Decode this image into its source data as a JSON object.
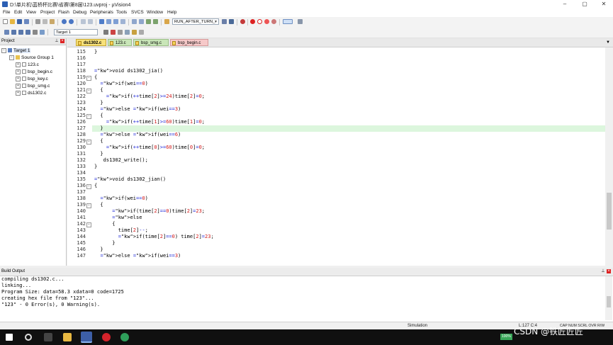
{
  "window": {
    "title": "D:\\单片机\\蓝桥杯比赛\\省赛\\第8届\\123.uvproj - µVision4",
    "minimize": "–",
    "maximize": "▢",
    "close": "✕"
  },
  "menu": [
    "File",
    "Edit",
    "View",
    "Project",
    "Flash",
    "Debug",
    "Peripherals",
    "Tools",
    "SVCS",
    "Window",
    "Help"
  ],
  "toolbar": {
    "command_combo": "RUN_AFTER_TURN_",
    "target_combo": "Target 1"
  },
  "project_pane": {
    "title": "Project",
    "tree": {
      "target": "Target 1",
      "group": "Source Group 1",
      "files": [
        "123.c",
        "bsp_begin.c",
        "bsp_key.c",
        "bsp_smg.c",
        "ds1302.c"
      ]
    }
  },
  "editor": {
    "tabs": [
      {
        "label": "ds1302.c",
        "active": true
      },
      {
        "label": "123.c",
        "active": false
      },
      {
        "label": "bsp_smg.c",
        "active": false
      },
      {
        "label": "bsp_begin.c",
        "active": false
      }
    ],
    "cursor_line": "127",
    "lines": [
      {
        "n": "115",
        "t": "}",
        "fold": ""
      },
      {
        "n": "116",
        "t": "",
        "fold": ""
      },
      {
        "n": "117",
        "t": "",
        "fold": ""
      },
      {
        "n": "118",
        "t": "void ds1302_jia()",
        "fold": ""
      },
      {
        "n": "119",
        "t": "{",
        "fold": "−"
      },
      {
        "n": "120",
        "t": "  if(wei==0)",
        "fold": ""
      },
      {
        "n": "121",
        "t": "  {",
        "fold": "−"
      },
      {
        "n": "122",
        "t": "    if(++time[2]>=24)time[2]=0;",
        "fold": ""
      },
      {
        "n": "123",
        "t": "  }",
        "fold": ""
      },
      {
        "n": "124",
        "t": "  else if(wei==3)",
        "fold": ""
      },
      {
        "n": "125",
        "t": "  {",
        "fold": "−"
      },
      {
        "n": "126",
        "t": "    if(++time[1]>=60)time[1]=0;",
        "fold": ""
      },
      {
        "n": "127",
        "t": "  }",
        "fold": ""
      },
      {
        "n": "128",
        "t": "  else if(wei==6)",
        "fold": ""
      },
      {
        "n": "129",
        "t": "  {",
        "fold": "−"
      },
      {
        "n": "130",
        "t": "    if(++time[0]>=60)time[0]=0;",
        "fold": ""
      },
      {
        "n": "131",
        "t": "  }",
        "fold": ""
      },
      {
        "n": "132",
        "t": "   ds1302_write();",
        "fold": ""
      },
      {
        "n": "133",
        "t": "}",
        "fold": ""
      },
      {
        "n": "134",
        "t": "",
        "fold": ""
      },
      {
        "n": "135",
        "t": "void ds1302_jian()",
        "fold": ""
      },
      {
        "n": "136",
        "t": "{",
        "fold": "−"
      },
      {
        "n": "137",
        "t": "",
        "fold": ""
      },
      {
        "n": "138",
        "t": "  if(wei==0)",
        "fold": ""
      },
      {
        "n": "139",
        "t": "  {",
        "fold": "−"
      },
      {
        "n": "140",
        "t": "      if(time[2]==0)time[2]=23;",
        "fold": ""
      },
      {
        "n": "141",
        "t": "      else",
        "fold": ""
      },
      {
        "n": "142",
        "t": "      {",
        "fold": "−"
      },
      {
        "n": "143",
        "t": "        time[2]--;",
        "fold": ""
      },
      {
        "n": "144",
        "t": "        if(time[2]==0) time[2]=23;",
        "fold": ""
      },
      {
        "n": "145",
        "t": "      }",
        "fold": ""
      },
      {
        "n": "146",
        "t": "  }",
        "fold": ""
      },
      {
        "n": "147",
        "t": "  else if(wei==3)",
        "fold": ""
      }
    ]
  },
  "build_output": {
    "title": "Build Output",
    "lines": [
      "compiling ds1302.c...",
      "linking...",
      "Program Size: data=58.3 xdata=0 code=1725",
      "creating hex file from \"123\"...",
      "\"123\" - 0 Error(s), 0 Warning(s)."
    ]
  },
  "statusbar": {
    "mode": "Simulation",
    "position": "L:127 C:4",
    "indicators": "CAP NUM SCRL OVR R/W"
  },
  "taskbar": {
    "tray_badge": "100%",
    "watermark": "CSDN @铁匠匠匠"
  },
  "colors": {
    "keyword": "#1e27d6",
    "number": "#d11a1a",
    "current_line": "#dcf6dd",
    "active_tab": "#f7e17a"
  }
}
